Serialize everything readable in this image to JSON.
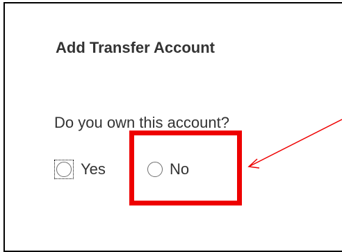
{
  "dialog": {
    "title": "Add Transfer Account",
    "question": "Do you own this account?",
    "options": [
      {
        "label": "Yes",
        "selected": false,
        "focused": true
      },
      {
        "label": "No",
        "selected": false,
        "focused": false
      }
    ]
  },
  "annotation": {
    "highlight_color": "#ee0000",
    "arrow_color": "#ee0000"
  }
}
